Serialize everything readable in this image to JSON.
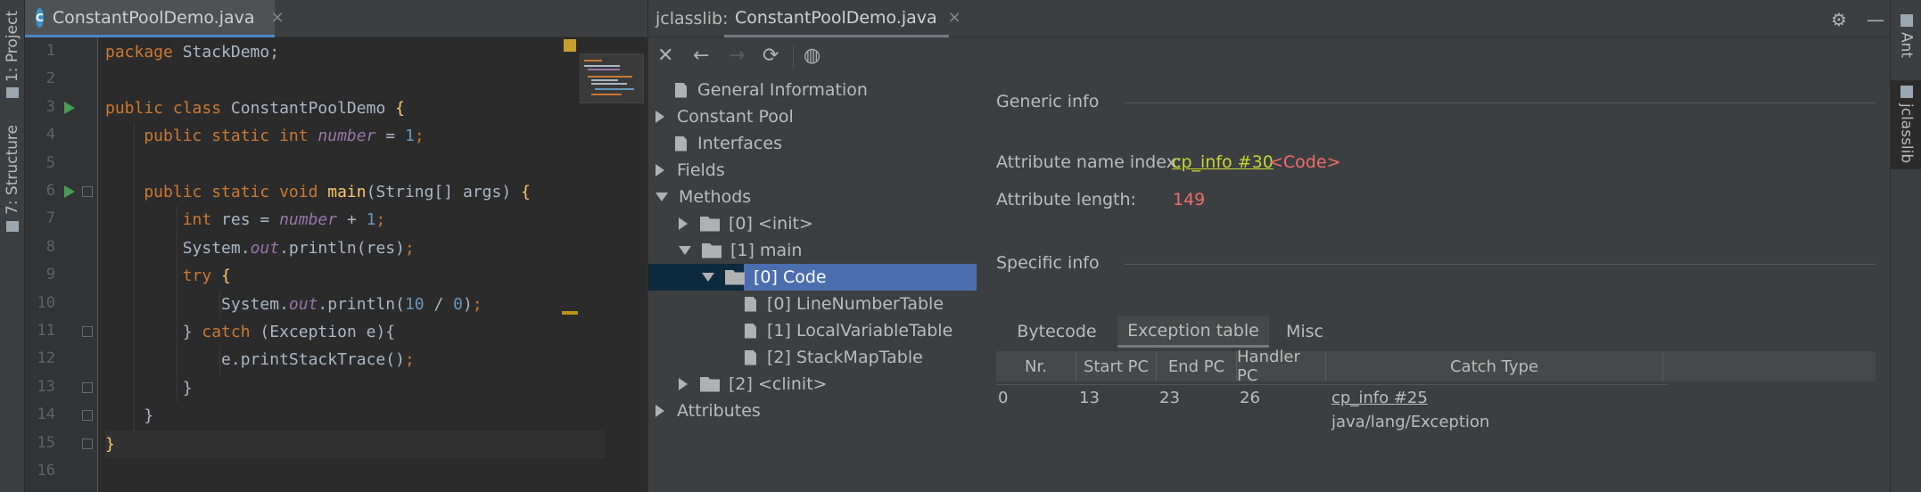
{
  "left_strip": {
    "project_label": "1: Project",
    "structure_label": "7: Structure"
  },
  "editor": {
    "tab_title": "ConstantPoolDemo.java",
    "tab_icon": "C",
    "close_glyph": "×",
    "line_numbers": [
      "1",
      "2",
      "3",
      "4",
      "5",
      "6",
      "7",
      "8",
      "9",
      "10",
      "11",
      "12",
      "13",
      "14",
      "15",
      "16"
    ],
    "lines": [
      [
        {
          "t": "package ",
          "c": "kw"
        },
        {
          "t": "StackDemo;",
          "c": ""
        }
      ],
      [],
      [
        {
          "t": "public class ",
          "c": "kw"
        },
        {
          "t": "ConstantPoolDemo ",
          "c": ""
        },
        {
          "t": "{",
          "c": "fn"
        }
      ],
      [
        {
          "t": "    public static int ",
          "c": "kw"
        },
        {
          "t": "number",
          "c": "fld"
        },
        {
          "t": " = ",
          "c": ""
        },
        {
          "t": "1",
          "c": "num"
        },
        {
          "t": ";",
          "c": "kw"
        }
      ],
      [],
      [
        {
          "t": "    public static void ",
          "c": "kw"
        },
        {
          "t": "main",
          "c": "fn"
        },
        {
          "t": "(String[] args) ",
          "c": ""
        },
        {
          "t": "{",
          "c": "fn"
        }
      ],
      [
        {
          "t": "        int ",
          "c": "kw"
        },
        {
          "t": "res = ",
          "c": ""
        },
        {
          "t": "number",
          "c": "fld"
        },
        {
          "t": " + ",
          "c": ""
        },
        {
          "t": "1",
          "c": "num"
        },
        {
          "t": ";",
          "c": "kw"
        }
      ],
      [
        {
          "t": "        System.",
          "c": ""
        },
        {
          "t": "out",
          "c": "fld"
        },
        {
          "t": ".println(res)",
          "c": ""
        },
        {
          "t": ";",
          "c": "kw"
        }
      ],
      [
        {
          "t": "        try ",
          "c": "kw"
        },
        {
          "t": "{",
          "c": "fn"
        }
      ],
      [
        {
          "t": "            System.",
          "c": ""
        },
        {
          "t": "out",
          "c": "fld"
        },
        {
          "t": ".println(",
          "c": ""
        },
        {
          "t": "10",
          "c": "num"
        },
        {
          "t": " / ",
          "c": ""
        },
        {
          "t": "0",
          "c": "num"
        },
        {
          "t": ")",
          "c": ""
        },
        {
          "t": ";",
          "c": "kw"
        }
      ],
      [
        {
          "t": "        } ",
          "c": ""
        },
        {
          "t": "catch ",
          "c": "kw"
        },
        {
          "t": "(Exception e){",
          "c": ""
        }
      ],
      [
        {
          "t": "            e.printStackTrace()",
          "c": ""
        },
        {
          "t": ";",
          "c": "kw"
        }
      ],
      [
        {
          "t": "        }",
          "c": ""
        }
      ],
      [
        {
          "t": "    }",
          "c": ""
        }
      ],
      [
        {
          "t": "}",
          "c": "fn"
        }
      ],
      []
    ]
  },
  "jclasslib": {
    "panel_label": "jclasslib:",
    "tab_title": "ConstantPoolDemo.java",
    "close_glyph": "×",
    "toolbar": {
      "close": "✕",
      "back": "←",
      "forward": "→",
      "refresh": "⟳",
      "browser": "◍"
    },
    "header_buttons": {
      "settings": "⚙",
      "minimize": "—"
    },
    "tree": [
      {
        "label": "General Information",
        "depth": 0,
        "icon": "file",
        "arrow": "none"
      },
      {
        "label": "Constant Pool",
        "depth": 0,
        "icon": "none",
        "arrow": "right"
      },
      {
        "label": "Interfaces",
        "depth": 0,
        "icon": "file",
        "arrow": "none"
      },
      {
        "label": "Fields",
        "depth": 0,
        "icon": "none",
        "arrow": "right"
      },
      {
        "label": "Methods",
        "depth": 0,
        "icon": "none",
        "arrow": "down"
      },
      {
        "label": "[0] <init>",
        "depth": 1,
        "icon": "folder",
        "arrow": "right"
      },
      {
        "label": "[1] main",
        "depth": 1,
        "icon": "folder",
        "arrow": "down"
      },
      {
        "label": "[0] Code",
        "depth": 2,
        "icon": "folder",
        "arrow": "down",
        "selected": true
      },
      {
        "label": "[0] LineNumberTable",
        "depth": 3,
        "icon": "file",
        "arrow": "none"
      },
      {
        "label": "[1] LocalVariableTable",
        "depth": 3,
        "icon": "file",
        "arrow": "none"
      },
      {
        "label": "[2] StackMapTable",
        "depth": 3,
        "icon": "file",
        "arrow": "none"
      },
      {
        "label": "[2] <clinit>",
        "depth": 1,
        "icon": "folder",
        "arrow": "right"
      },
      {
        "label": "Attributes",
        "depth": 0,
        "icon": "none",
        "arrow": "right"
      }
    ],
    "detail": {
      "generic_title": "Generic info",
      "attr_name_label": "Attribute name index:",
      "attr_name_link": "cp_info #30",
      "attr_name_value": "<Code>",
      "attr_length_label": "Attribute length:",
      "attr_length_value": "149",
      "specific_title": "Specific info",
      "tabs": [
        "Bytecode",
        "Exception table",
        "Misc"
      ],
      "active_tab": "Exception table",
      "table": {
        "headers": [
          "Nr.",
          "Start PC",
          "End PC",
          "Handler PC",
          "Catch Type"
        ],
        "rows": [
          {
            "nr": "0",
            "start_pc": "13",
            "end_pc": "23",
            "handler_pc": "26",
            "catch_link": "cp_info #25",
            "catch_type": "java/lang/Exception"
          }
        ]
      }
    }
  },
  "right_strip": {
    "ant_label": "Ant",
    "jclasslib_label": "jclasslib"
  },
  "colors": {
    "editor_bg": "#2b2b2b",
    "panel_bg": "#3c3f41",
    "keyword": "#cc7832",
    "number": "#6897bb",
    "field": "#9876aa",
    "function": "#ffc66d",
    "link": "#c5d62f",
    "code_value": "#f06b6b",
    "selection": "#4b6eaf"
  }
}
